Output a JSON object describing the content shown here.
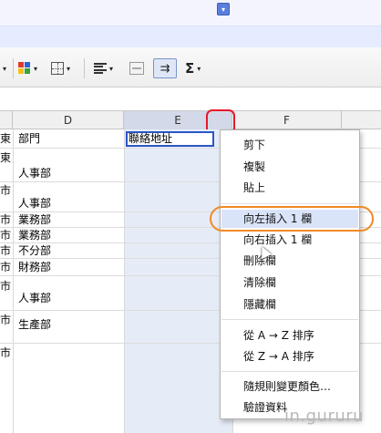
{
  "toolbar": {
    "icons": [
      "fill-color-icon",
      "borders-icon",
      "align-icon",
      "merge-cells-icon",
      "wrap-text-icon",
      "sigma-icon"
    ],
    "sigma_label": "Σ",
    "caret": "▾",
    "wrap_symbol": "⇉"
  },
  "columns": {
    "d": "D",
    "e": "E",
    "f": "F"
  },
  "column_menu_button": "▾",
  "cells": {
    "d_header": "部門",
    "e_header": "聯絡地址",
    "col_a": [
      "東",
      "東",
      "市",
      "市",
      "市",
      "市",
      "市",
      "市",
      "市",
      "市"
    ],
    "col_d": [
      "人事部",
      "人事部",
      "業務部",
      "業務部",
      "不分部",
      "財務部",
      "人事部",
      "生產部"
    ]
  },
  "context_menu": {
    "items": {
      "cut": "剪下",
      "copy": "複製",
      "paste": "貼上",
      "insert_left": "向左插入 1 欄",
      "insert_right": "向右插入 1 欄",
      "delete_column": "刪除欄",
      "clear_column": "清除欄",
      "hide_column": "隱藏欄",
      "sort_az": "從 A → Z 排序",
      "sort_za": "從 Z → A 排序",
      "change_colors": "隨規則變更顏色…",
      "validation": "驗證資料"
    },
    "highlighted": "insert_left"
  },
  "watermark": "in.gururu",
  "colors": {
    "selected_column": "#e6ecf7",
    "selection_border": "#2a56c6",
    "red_ring": "#e8192c",
    "orange_oval": "#f08a24",
    "menu_hover": "#dae4f8"
  }
}
